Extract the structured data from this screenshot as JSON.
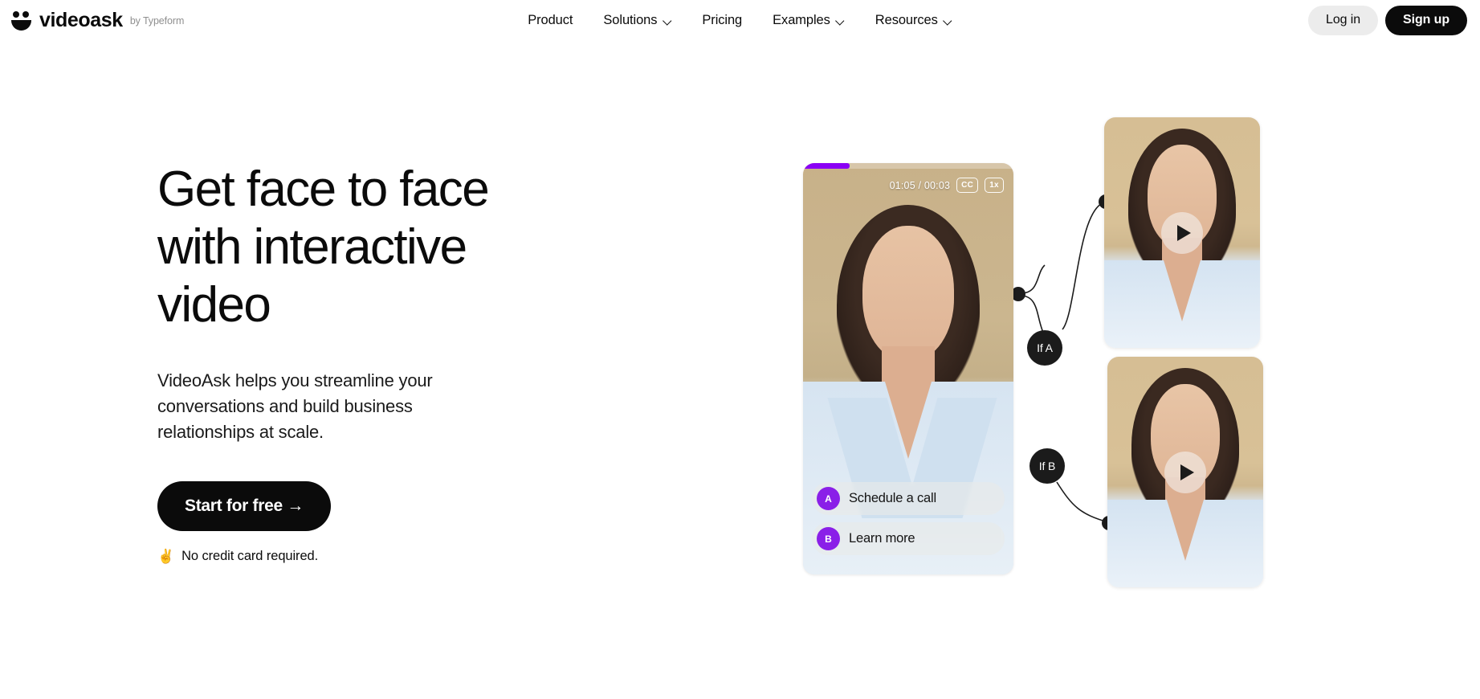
{
  "brand": {
    "logo_icon": "smiley-face-icon",
    "name": "videoask",
    "byline": "by Typeform"
  },
  "nav": {
    "items": [
      {
        "label": "Product",
        "has_dropdown": false
      },
      {
        "label": "Solutions",
        "has_dropdown": true
      },
      {
        "label": "Pricing",
        "has_dropdown": false
      },
      {
        "label": "Examples",
        "has_dropdown": true
      },
      {
        "label": "Resources",
        "has_dropdown": true
      }
    ],
    "login_label": "Log in",
    "signup_label": "Sign up"
  },
  "hero": {
    "headline": "Get face to face with interactive video",
    "subheadline": "VideoAsk helps you streamline your conversations and build business relationships at scale.",
    "cta_label": "Start for free →",
    "note_emoji": "✌️",
    "note_text": "No credit card required."
  },
  "player": {
    "time_display": "01:05 / 00:03",
    "captions_label": "CC",
    "speed_label": "1x",
    "progress_percent": 22,
    "answers": [
      {
        "key": "A",
        "label": "Schedule a call"
      },
      {
        "key": "B",
        "label": "Learn more"
      }
    ]
  },
  "flow": {
    "branch_a_label": "If A",
    "branch_b_label": "If B",
    "play_icon": "play-icon"
  },
  "colors": {
    "accent_purple": "#8a00f5",
    "badge_purple": "#8a1fe8",
    "black": "#0b0b0b",
    "light_gray": "#ececec"
  }
}
